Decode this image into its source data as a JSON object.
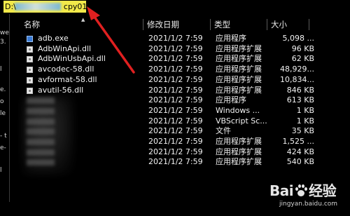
{
  "address_bar": {
    "prefix": "D:\\",
    "suffix": "cpy01"
  },
  "nav_pane": {
    "fragments": [
      "we",
      "3.",
      "l",
      "e.",
      "o",
      "le",
      "- t",
      "e-",
      "l"
    ]
  },
  "columns": [
    {
      "label": "名称"
    },
    {
      "label": "修改日期"
    },
    {
      "label": "类型"
    },
    {
      "label": "大小"
    }
  ],
  "files": [
    {
      "name": "adb.exe",
      "date": "2021/1/2 7:59",
      "type": "应用程序",
      "size": "5,098 ...",
      "icon": "exe-icon"
    },
    {
      "name": "AdbWinApi.dll",
      "date": "2021/1/2 7:59",
      "type": "应用程序扩展",
      "size": "96 KB",
      "icon": "dll-icon"
    },
    {
      "name": "AdbWinUsbApi.dll",
      "date": "2021/1/2 7:59",
      "type": "应用程序扩展",
      "size": "62 KB",
      "icon": "dll-icon"
    },
    {
      "name": "avcodec-58.dll",
      "date": "2021/1/2 7:59",
      "type": "应用程序扩展",
      "size": "48,929...",
      "icon": "dll-icon"
    },
    {
      "name": "avformat-58.dll",
      "date": "2021/1/2 7:59",
      "type": "应用程序扩展",
      "size": "10,834...",
      "icon": "dll-icon"
    },
    {
      "name": "avutil-56.dll",
      "date": "2021/1/2 7:59",
      "type": "应用程序扩展",
      "size": "846 KB",
      "icon": "dll-icon"
    },
    {
      "name": "",
      "date": "2021/1/2 7:59",
      "type": "应用程序",
      "size": "613 KB",
      "icon": "blurred"
    },
    {
      "name": "",
      "date": "2021/1/2 7:59",
      "type": "Windows ...",
      "size": "1 KB",
      "icon": "blurred"
    },
    {
      "name": "",
      "date": "2021/1/2 7:59",
      "type": "VBScript Sc...",
      "size": "1 KB",
      "icon": "blurred"
    },
    {
      "name": "",
      "date": "2021/1/2 7:59",
      "type": "文件",
      "size": "35 KB",
      "icon": "blurred"
    },
    {
      "name": "",
      "date": "2021/1/2 7:59",
      "type": "应用程序扩展",
      "size": "1,525 ...",
      "icon": "blurred"
    },
    {
      "name": "",
      "date": "2021/1/2 7:59",
      "type": "应用程序扩展",
      "size": "424 KB",
      "icon": "blurred"
    },
    {
      "name": "",
      "date": "2021/1/2 7:59",
      "type": "应用程序扩展",
      "size": "540 KB",
      "icon": "blurred"
    }
  ],
  "watermark": {
    "logo_left": "Bai",
    "logo_right": "经验",
    "url": "jingyan.baidu.com"
  },
  "colors": {
    "address_highlight": "#f2e94a",
    "annotation_arrow": "#e02020",
    "background": "#000000"
  }
}
